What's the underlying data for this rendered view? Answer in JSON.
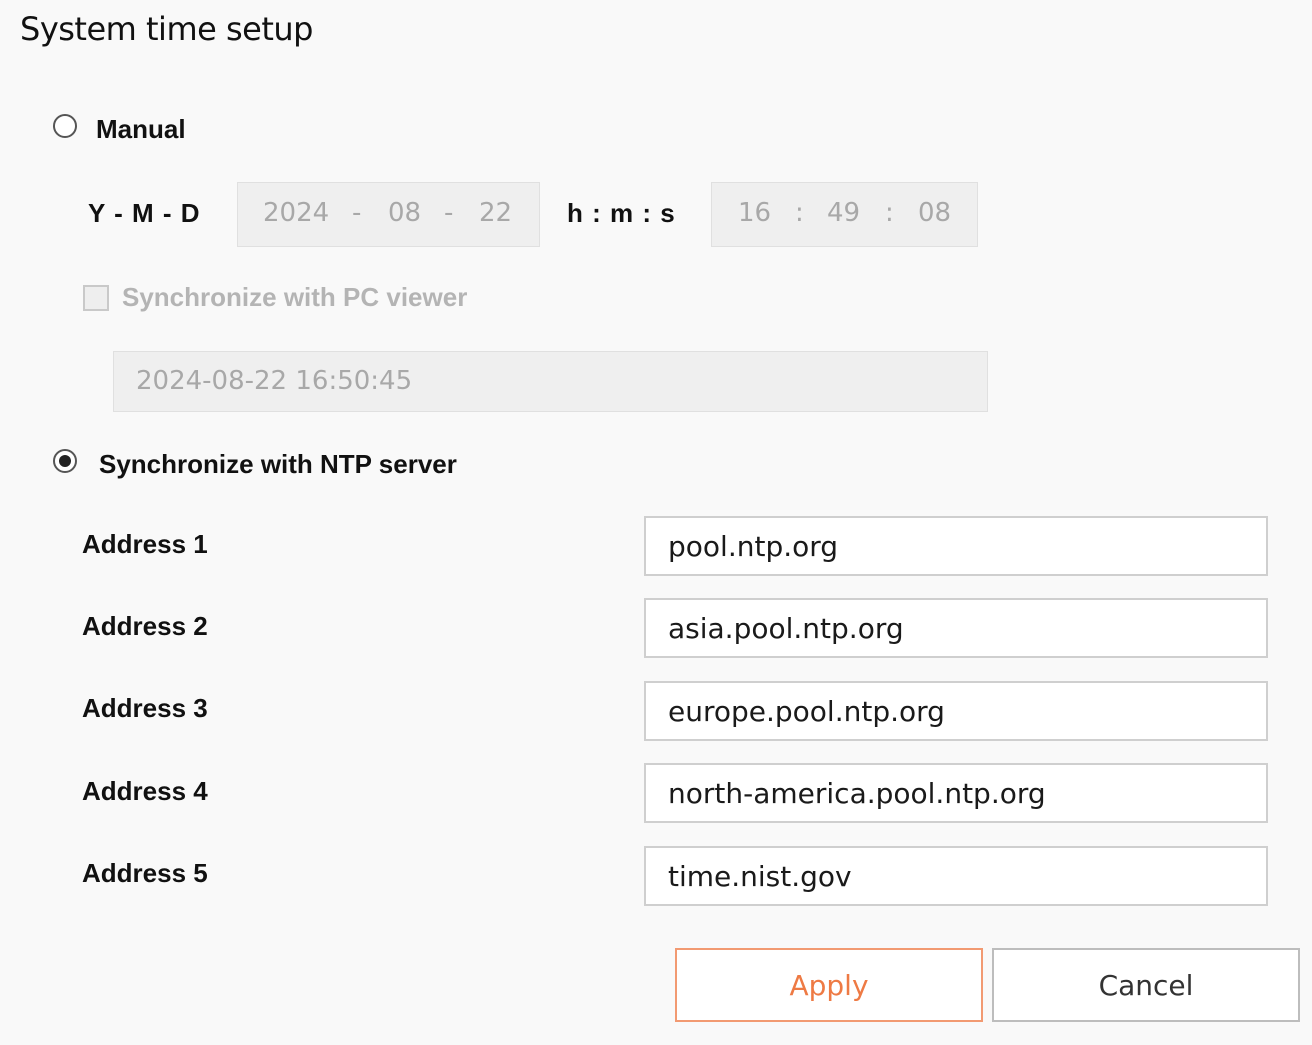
{
  "page": {
    "title": "System time setup"
  },
  "manual": {
    "label": "Manual",
    "checked": false,
    "date_format_label": "Y - M - D",
    "year": "2024",
    "month": "08",
    "day": "22",
    "date_separator": "-",
    "time_format_label": "h : m : s",
    "hour": "16",
    "minute": "49",
    "second": "08",
    "time_separator": ":",
    "sync_pc_label": "Synchronize with PC viewer",
    "sync_pc_checked": false,
    "pc_time": "2024-08-22 16:50:45"
  },
  "ntp": {
    "label": "Synchronize with NTP server",
    "checked": true,
    "addresses": [
      {
        "label": "Address 1",
        "value": "pool.ntp.org"
      },
      {
        "label": "Address 2",
        "value": "asia.pool.ntp.org"
      },
      {
        "label": "Address 3",
        "value": "europe.pool.ntp.org"
      },
      {
        "label": "Address 4",
        "value": "north-america.pool.ntp.org"
      },
      {
        "label": "Address 5",
        "value": "time.nist.gov"
      }
    ]
  },
  "actions": {
    "apply_label": "Apply",
    "cancel_label": "Cancel"
  },
  "colors": {
    "apply_text": "#ee7a44",
    "apply_border": "#f29a72",
    "disabled_text": "#a8a8a8",
    "background": "#f9f9f9"
  }
}
